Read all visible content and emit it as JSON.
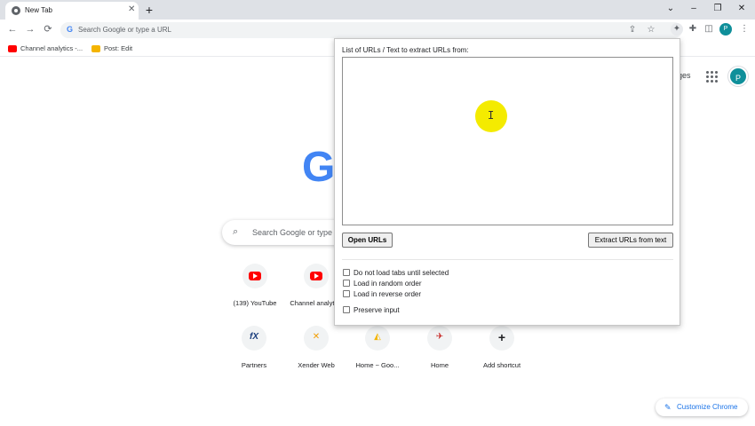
{
  "browser": {
    "tab_title": "New Tab",
    "tab_close": "✕",
    "new_tab": "+",
    "window_controls": {
      "dropdown": "⌄",
      "minimize": "–",
      "restore": "❐",
      "close": "✕"
    }
  },
  "toolbar": {
    "back": "←",
    "forward": "→",
    "reload": "⟳",
    "omnibox_g": "G",
    "omnibox_placeholder": "Search Google or type a URL",
    "share": "⇪",
    "star": "☆",
    "ext": "✦",
    "puzzle": "✚",
    "sidepanel": "◫",
    "menu": "⋮",
    "avatar": "P"
  },
  "bookmarks": [
    {
      "label": "Channel analytics -...",
      "color": "#ff0000"
    },
    {
      "label": "Post: Edit",
      "color": "#f4b400"
    }
  ],
  "ntp": {
    "right_text": "ges",
    "avatar": "P",
    "logo": "G",
    "search_placeholder": "Search Google or type a URL",
    "search_icon": "⌕",
    "shortcuts": [
      {
        "label": "(139) YouTube",
        "icon": "youtube-icon"
      },
      {
        "label": "Channel analytics",
        "icon": "youtube-icon"
      },
      {
        "label": "Partners",
        "icon": "fx-icon",
        "glyph": "fX"
      },
      {
        "label": "Xender Web",
        "icon": "xender-icon",
        "glyph": "✕"
      },
      {
        "label": "Home ~ Goo...",
        "icon": "drive-icon",
        "glyph": "◭"
      },
      {
        "label": "Home",
        "icon": "home-site-icon",
        "glyph": "✈"
      },
      {
        "label": "Add shortcut",
        "icon": "plus-icon",
        "glyph": "+"
      }
    ],
    "customize": "Customize Chrome",
    "customize_icon": "✎"
  },
  "popup": {
    "header": "List of URLs / Text to extract URLs from:",
    "textarea_value": "",
    "open_button": "Open URLs",
    "extract_button": "Extract URLs from text",
    "options": [
      {
        "label": "Do not load tabs until selected",
        "checked": false
      },
      {
        "label": "Load in random order",
        "checked": false
      },
      {
        "label": "Load in reverse order",
        "checked": false
      },
      {
        "label": "Preserve input",
        "checked": false
      }
    ]
  },
  "colors": {
    "accent": "#1a73e8",
    "avatar": "#0f8f9a",
    "cursor_highlight": "#f4eb00",
    "tabstrip": "#dee1e6"
  },
  "cursor": "I"
}
